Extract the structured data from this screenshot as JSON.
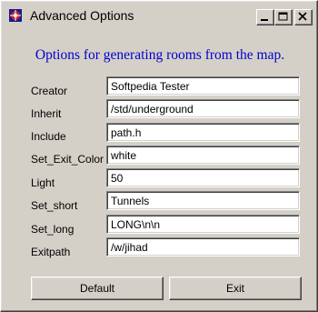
{
  "window": {
    "title": "Advanced Options",
    "icon": "app-icon"
  },
  "heading": "Options for generating rooms from the map.",
  "fields": [
    {
      "label": "Creator",
      "value": "Softpedia Tester"
    },
    {
      "label": "Inherit",
      "value": "/std/underground"
    },
    {
      "label": "Include",
      "value": "path.h"
    },
    {
      "label": "Set_Exit_Color",
      "value": "white"
    },
    {
      "label": "Light",
      "value": "50"
    },
    {
      "label": "Set_short",
      "value": "Tunnels"
    },
    {
      "label": "Set_long",
      "value": "LONG\\n\\n"
    },
    {
      "label": "Exitpath",
      "value": "/w/jihad"
    }
  ],
  "buttons": {
    "default": "Default",
    "exit": "Exit"
  }
}
